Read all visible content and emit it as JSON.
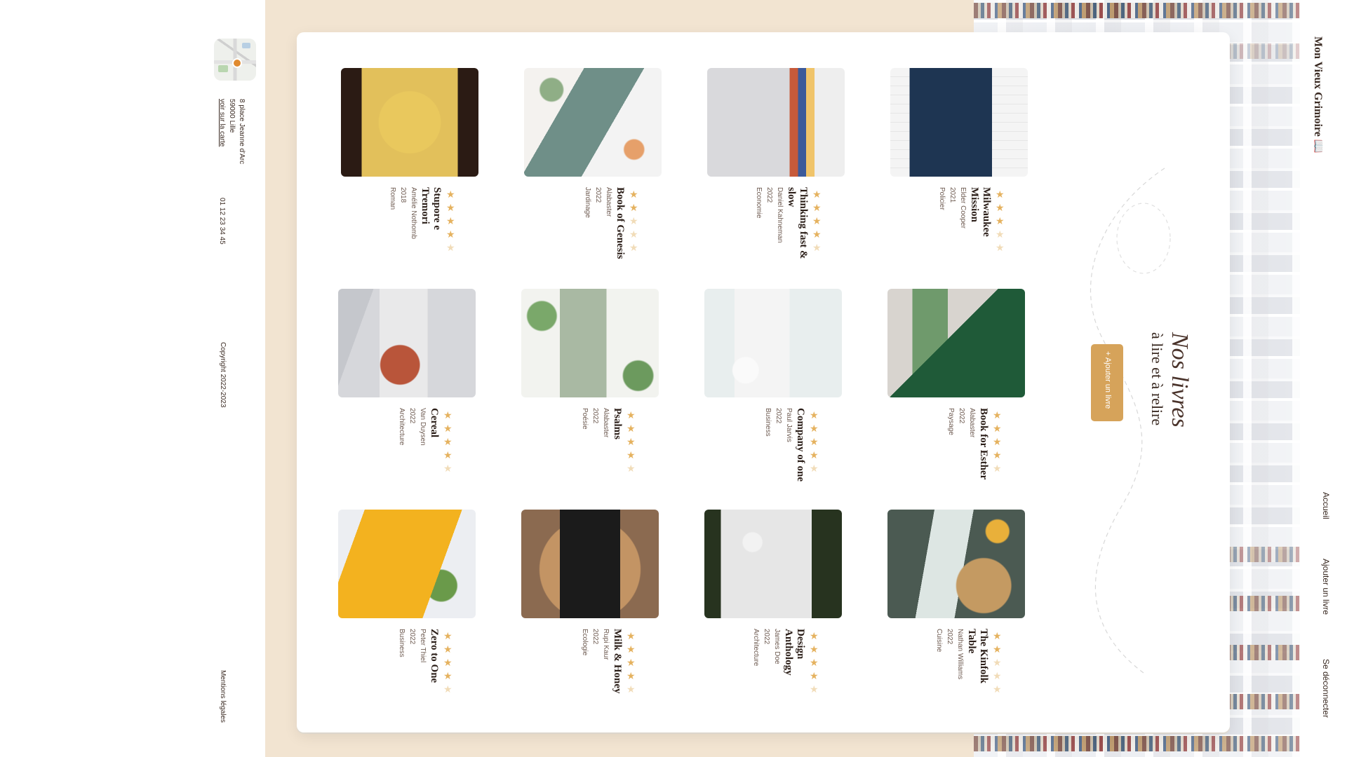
{
  "left_column": {
    "address_line1": "8 place Jeanne d'Arc",
    "address_line2": "59000 Lille",
    "map_link": "voir sur la carte",
    "phone": "01 12 23 34 45",
    "copyright": "Copyright 2022-2023",
    "legal": "Mentions légales"
  },
  "nav": {
    "logo": "Mon Vieux Grimoire 📖",
    "home": "Accueil",
    "add_book": "Ajouter un livre",
    "logout": "Se déconnecter"
  },
  "hero": {
    "title": "Nos livres",
    "subtitle": "à lire et à relire",
    "add_button": "+ Ajouter un livre"
  },
  "colors": {
    "accent": "#d6a35a",
    "beige": "#f2e4d1",
    "star": "#e5b25f"
  },
  "books": [
    {
      "title": "Stupore e Tremori",
      "author": "Amélie Nothomb",
      "year": "2018",
      "genre": "Roman",
      "rating": 4,
      "cover": "glasses-yellow"
    },
    {
      "title": "Book of Genesis",
      "author": "Alabaster",
      "year": "2022",
      "genre": "Jardinage",
      "rating": 2,
      "cover": "flowers-white"
    },
    {
      "title": "Thinking fast & slow",
      "author": "Daniel Kahneman",
      "year": "2022",
      "genre": "Economie",
      "rating": 4,
      "cover": "stack-white"
    },
    {
      "title": "Milwaukee Mission",
      "author": "Elder Cooper",
      "year": "2021",
      "genre": "Policier",
      "rating": 3,
      "cover": "navy-brick"
    },
    {
      "title": "Cereal",
      "author": "Van Duysen",
      "year": "2022",
      "genre": "Architecture",
      "rating": 4,
      "cover": "sheets-grey"
    },
    {
      "title": "Psalms",
      "author": "Alabaster",
      "year": "2022",
      "genre": "Poésie",
      "rating": 4,
      "cover": "leaves-white"
    },
    {
      "title": "Company of one",
      "author": "Paul Jarvis",
      "year": "2022",
      "genre": "Business",
      "rating": 4,
      "cover": "orchid-white"
    },
    {
      "title": "Book for Esther",
      "author": "Alabaster",
      "year": "2022",
      "genre": "Paysage",
      "rating": 4,
      "cover": "green-fold"
    },
    {
      "title": "Zero to One",
      "author": "Peter Thiel",
      "year": "2022",
      "genre": "Business",
      "rating": 4,
      "cover": "yellow-hand"
    },
    {
      "title": "Milk & Honey",
      "author": "Rupi Kaur",
      "year": "2022",
      "genre": "Ecologie",
      "rating": 4,
      "cover": "wood-black"
    },
    {
      "title": "Design Anthology",
      "author": "James Doe",
      "year": "2022",
      "genre": "Architecture",
      "rating": 4,
      "cover": "dark-green"
    },
    {
      "title": "The Kinfolk Table",
      "author": "Nathan Williams",
      "year": "2022",
      "genre": "Cuisine",
      "rating": 2,
      "cover": "hat-tulips"
    }
  ]
}
